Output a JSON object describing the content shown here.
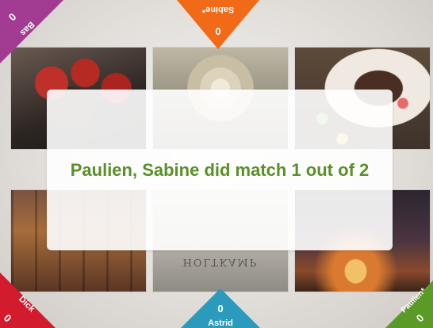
{
  "players": {
    "bas": {
      "name": "Bas",
      "score": "0",
      "color": "#a23c93"
    },
    "sabine": {
      "name": "Sabine*",
      "score": "0",
      "color": "#f06a18"
    },
    "dick": {
      "name": "Dick",
      "score": "0",
      "color": "#d21b2c"
    },
    "astrid": {
      "name": "Astrid",
      "score": "0",
      "color": "#2a9bbd"
    },
    "paulien": {
      "name": "Paulien*",
      "score": "0",
      "color": "#5a9a27"
    }
  },
  "tiles": [
    {
      "subject": "strawberries"
    },
    {
      "subject": "rose"
    },
    {
      "subject": "cake"
    },
    {
      "subject": "window"
    },
    {
      "subject": "cup",
      "text": "HOLTKAMP"
    },
    {
      "subject": "sunset"
    }
  ],
  "message": {
    "text": "Paulien, Sabine did match 1 out of 2",
    "color": "#5a8f2a"
  }
}
